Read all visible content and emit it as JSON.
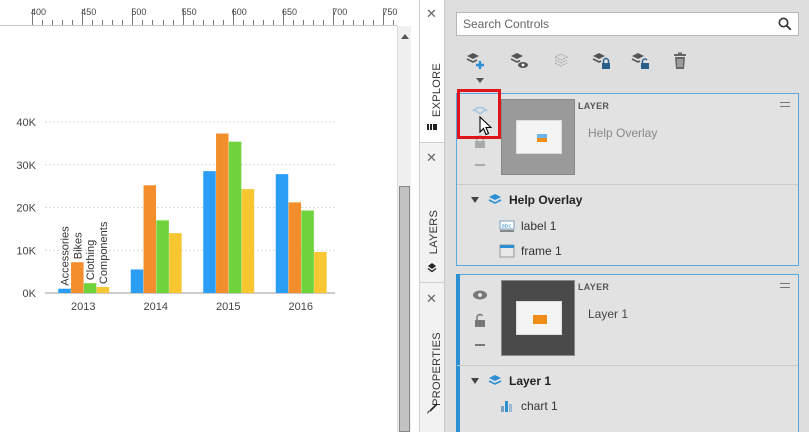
{
  "ruler": {
    "labels": [
      "400",
      "450",
      "500",
      "550",
      "600",
      "650",
      "700",
      "750"
    ]
  },
  "chart_data": {
    "type": "bar",
    "categories": [
      "2013",
      "2014",
      "2015",
      "2016"
    ],
    "series": [
      {
        "name": "Accessories",
        "color": "#2a9df4",
        "values": [
          1000,
          5500,
          28500,
          27800
        ]
      },
      {
        "name": "Bikes",
        "color": "#f28e2b",
        "values": [
          7200,
          25200,
          37300,
          21200
        ]
      },
      {
        "name": "Clothing",
        "color": "#6fd33b",
        "values": [
          2300,
          17000,
          35400,
          19300
        ]
      },
      {
        "name": "Components",
        "color": "#f8c630",
        "values": [
          1400,
          14000,
          24300,
          9600
        ]
      }
    ],
    "yticks": [
      "0K",
      "10K",
      "20K",
      "30K",
      "40K"
    ],
    "ylim": [
      0,
      40000
    ],
    "grid": true,
    "series_labels_rotated_over_first_group": true
  },
  "tabs": {
    "explore": "EXPLORE",
    "layers": "LAYERS",
    "properties": "PROPERTIES",
    "close": "✕"
  },
  "search": {
    "placeholder": "Search Controls"
  },
  "layers": [
    {
      "type": "LAYER",
      "name": "Help Overlay",
      "tree_title": "Help Overlay",
      "children": [
        "label 1",
        "frame 1"
      ]
    },
    {
      "type": "LAYER",
      "name": "Layer 1",
      "tree_title": "Layer 1",
      "children": [
        "chart 1"
      ]
    }
  ],
  "colors": {
    "accent": "#2b8fd4",
    "highlight": "#e0141b"
  }
}
